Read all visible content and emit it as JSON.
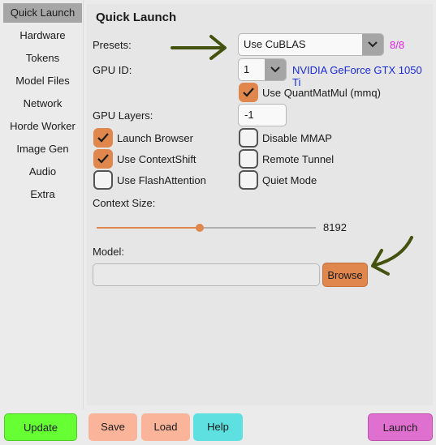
{
  "sidebar": {
    "items": [
      {
        "label": "Quick Launch"
      },
      {
        "label": "Hardware"
      },
      {
        "label": "Tokens"
      },
      {
        "label": "Model Files"
      },
      {
        "label": "Network"
      },
      {
        "label": "Horde Worker"
      },
      {
        "label": "Image Gen"
      },
      {
        "label": "Audio"
      },
      {
        "label": "Extra"
      }
    ]
  },
  "main": {
    "title": "Quick Launch",
    "presets": {
      "label": "Presets:",
      "value": "Use CuBLAS",
      "count": "8/8"
    },
    "gpu": {
      "label": "GPU ID:",
      "value": "1",
      "name": "NVIDIA GeForce GTX 1050 Ti"
    },
    "quantmatmul": {
      "label": "Use QuantMatMul (mmq)",
      "checked": true
    },
    "gpu_layers": {
      "label": "GPU Layers:",
      "value": "-1"
    },
    "checkboxes": [
      {
        "label": "Launch Browser",
        "checked": true
      },
      {
        "label": "Disable MMAP",
        "checked": false
      },
      {
        "label": "Use ContextShift",
        "checked": true
      },
      {
        "label": "Remote Tunnel",
        "checked": false
      },
      {
        "label": "Use FlashAttention",
        "checked": false
      },
      {
        "label": "Quiet Mode",
        "checked": false
      }
    ],
    "context": {
      "label": "Context Size:",
      "value": "8192",
      "position": 0.47
    },
    "model": {
      "label": "Model:",
      "value": "",
      "browse": "Browse"
    }
  },
  "footer": {
    "update": "Update",
    "save": "Save",
    "load": "Load",
    "help": "Help",
    "launch": "Launch"
  },
  "colors": {
    "accent": "#e0874e",
    "update": "#66ff33",
    "save_load": "#f9b49a",
    "help": "#5ee0e0",
    "launch": "#e070d0",
    "count": "#e020e0",
    "gpu_name": "#1a2bd8",
    "arrow": "#445210"
  },
  "icons": {
    "dropdown": "chevron-down-icon",
    "check": "check-icon",
    "annotation": "arrow-icon"
  }
}
